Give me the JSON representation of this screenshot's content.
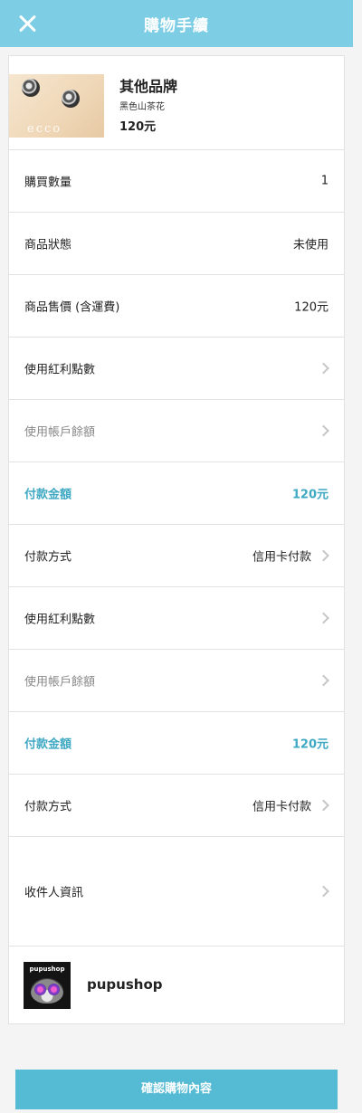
{
  "header": {
    "title": "購物手續",
    "close_icon": "close-icon"
  },
  "product": {
    "brand": "其他品牌",
    "variant": "黑色山茶花",
    "price": "120元"
  },
  "rows": [
    {
      "label": "購買數量",
      "value": "1"
    },
    {
      "label": "商品狀態",
      "value": "未使用"
    },
    {
      "label": "商品售價 (含運費)",
      "value": "120元"
    },
    {
      "label": "使用紅利點數"
    },
    {
      "label": "使用帳戶餘額"
    },
    {
      "label": "付款金額",
      "value": "120元"
    },
    {
      "label": "付款方式",
      "value": "信用卡付款"
    },
    {
      "label": "使用紅利點數"
    },
    {
      "label": "使用帳戶餘額"
    },
    {
      "label": "付款金額",
      "value": "120元"
    },
    {
      "label": "付款方式",
      "value": "信用卡付款"
    },
    {
      "label": "收件人資訊"
    }
  ],
  "shop": {
    "name": "pupushop",
    "avatar_text": "pupushop"
  },
  "confirm_label": "確認購物內容",
  "colors": {
    "header": "#7dcde4",
    "accent": "#3fa8c3",
    "button": "#55bad3"
  }
}
